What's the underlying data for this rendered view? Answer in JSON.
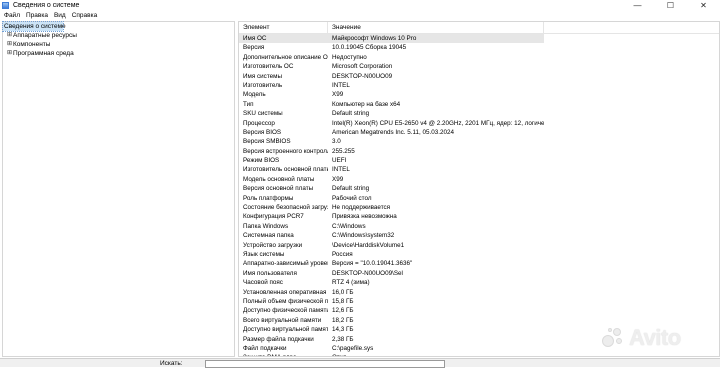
{
  "window": {
    "title": "Сведения о системе",
    "minimize_glyph": "—",
    "maximize_glyph": "☐",
    "close_glyph": "✕"
  },
  "menu": [
    "Файл",
    "Правка",
    "Вид",
    "Справка"
  ],
  "tree": {
    "root": "Сведения о системе",
    "children": [
      "Аппаратные ресурсы",
      "Компоненты",
      "Программная среда"
    ],
    "expander_glyph": "⊞"
  },
  "table": {
    "columns": [
      "Элемент",
      "Значение"
    ],
    "rows": [
      {
        "item": "Имя ОС",
        "value": "Майкрософт Windows 10 Pro"
      },
      {
        "item": "Версия",
        "value": "10.0.19045 Сборка 19045"
      },
      {
        "item": "Дополнительное описание ОС",
        "value": "Недоступно"
      },
      {
        "item": "Изготовитель ОС",
        "value": "Microsoft Corporation"
      },
      {
        "item": "Имя системы",
        "value": "DESKTOP-N00UO09"
      },
      {
        "item": "Изготовитель",
        "value": "INTEL"
      },
      {
        "item": "Модель",
        "value": "X99"
      },
      {
        "item": "Тип",
        "value": "Компьютер на базе x64"
      },
      {
        "item": "SKU системы",
        "value": "Default string"
      },
      {
        "item": "Процессор",
        "value": "Intel(R) Xeon(R) CPU E5-2650 v4 @ 2.20GHz, 2201 МГц, ядер: 12, логических ..."
      },
      {
        "item": "Версия BIOS",
        "value": "American Megatrends Inc. 5.11, 05.03.2024"
      },
      {
        "item": "Версия SMBIOS",
        "value": "3.0"
      },
      {
        "item": "Версия встроенного контролл...",
        "value": "255.255"
      },
      {
        "item": "Режим BIOS",
        "value": "UEFI"
      },
      {
        "item": "Изготовитель основной платы",
        "value": "INTEL"
      },
      {
        "item": "Модель основной платы",
        "value": "X99"
      },
      {
        "item": "Версия основной платы",
        "value": "Default string"
      },
      {
        "item": "Роль платформы",
        "value": "Рабочий стол"
      },
      {
        "item": "Состояние безопасной загруз...",
        "value": "Не поддерживается"
      },
      {
        "item": "Конфигурация PCR7",
        "value": "Привязка невозможна"
      },
      {
        "item": "Папка Windows",
        "value": "C:\\Windows"
      },
      {
        "item": "Системная папка",
        "value": "C:\\Windows\\system32"
      },
      {
        "item": "Устройство загрузки",
        "value": "\\Device\\HarddiskVolume1"
      },
      {
        "item": "Язык системы",
        "value": "Россия"
      },
      {
        "item": "Аппаратно-зависимый уровен...",
        "value": "Версия = \"10.0.19041.3636\""
      },
      {
        "item": "Имя пользователя",
        "value": "DESKTOP-N00UO09\\Sel"
      },
      {
        "item": "Часовой пояс",
        "value": "RTZ 4 (зима)"
      },
      {
        "item": "Установленная оперативная п...",
        "value": "16,0 ГБ"
      },
      {
        "item": "Полный объем физической па...",
        "value": "15,8 ГБ"
      },
      {
        "item": "Доступно физической памяти",
        "value": "12,6 ГБ"
      },
      {
        "item": "Всего виртуальной памяти",
        "value": "18,2 ГБ"
      },
      {
        "item": "Доступно виртуальной памяти",
        "value": "14,3 ГБ"
      },
      {
        "item": "Размер файла подкачки",
        "value": "2,38 ГБ"
      },
      {
        "item": "Файл подкачки",
        "value": "C:\\pagefile.sys"
      },
      {
        "item": "Защита DMA ядра",
        "value": "Откл."
      }
    ]
  },
  "search": {
    "label": "Искать:",
    "value": ""
  },
  "watermark": {
    "text": "Avito"
  }
}
